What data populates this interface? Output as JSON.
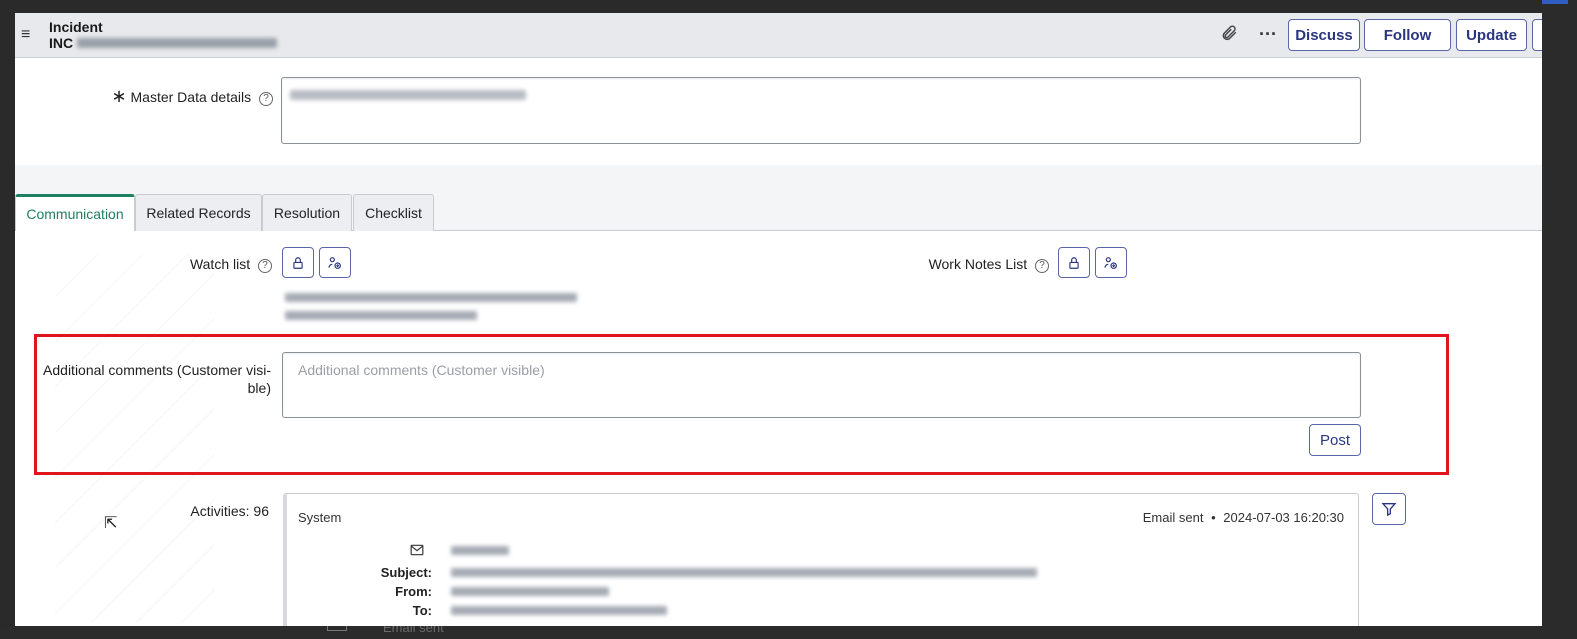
{
  "header": {
    "title": "Incident",
    "number_prefix": "INC",
    "buttons": {
      "discuss": "Discuss",
      "follow": "Follow",
      "update": "Update"
    },
    "icons": {
      "menu": "hamburger-menu-icon",
      "attach": "paperclip-icon",
      "more": "more-options-icon"
    }
  },
  "form": {
    "master_data_label": "Master Data details",
    "required_marker": "∗",
    "tabs": [
      "Communication",
      "Related Records",
      "Resolution",
      "Checklist"
    ],
    "active_tab": "Communication",
    "watch_list_label": "Watch list",
    "work_notes_list_label": "Work Notes List",
    "additional_comments_label_line1": "Additional comments (Customer visi-",
    "additional_comments_label_line2": "ble)",
    "additional_comments_placeholder": "Additional comments (Customer visible)",
    "post_label": "Post",
    "activities_label": "Activities: 96"
  },
  "activity": {
    "author": "System",
    "type": "Email sent",
    "separator": "•",
    "timestamp": "2024-07-03 16:20:30",
    "subject_label": "Subject:",
    "from_label": "From:",
    "to_label": "To:"
  },
  "background": {
    "ghost_text": "Email sent"
  },
  "colors": {
    "accent": "#2b3680",
    "active_tab": "#1e7f61",
    "highlight_box": "#e0141b"
  }
}
